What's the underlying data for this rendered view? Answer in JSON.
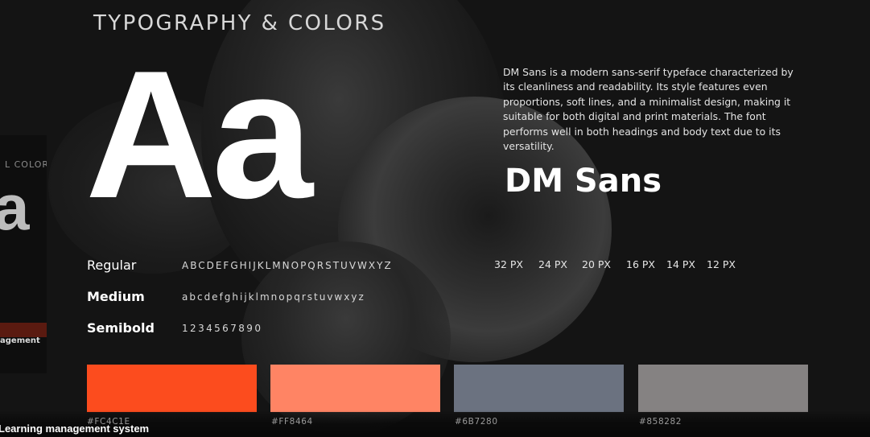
{
  "header": {
    "title": "TYPOGRAPHY & COLORS"
  },
  "specimen": {
    "big_glyphs": "Aa",
    "font_name": "DM Sans",
    "description": "DM Sans is a modern sans-serif typeface characterized by its cleanliness and readability. Its style features even proportions, soft lines, and a minimalist design, making it suitable for both digital and print materials. The font performs well in both headings and body text due to its versatility."
  },
  "weights": [
    {
      "label": "Regular"
    },
    {
      "label": "Medium"
    },
    {
      "label": "Semibold"
    }
  ],
  "glyph_rows": {
    "uppercase": "ABCDEFGHIJKLMNOPQRSTUVWXYZ",
    "lowercase": "abcdefghijklmnopqrstuvwxyz",
    "digits": "1234567890"
  },
  "sizes": [
    "32 PX",
    "24 PX",
    "20 PX",
    "16 PX",
    "14 PX",
    "12 PX"
  ],
  "palette": [
    {
      "hex": "#FC4C1E",
      "color": "#FC4C1E"
    },
    {
      "hex": "#FF8464",
      "color": "#FF8464"
    },
    {
      "hex": "#6B7280",
      "color": "#6B7280"
    },
    {
      "hex": "#858282",
      "color": "#858282"
    }
  ],
  "ghost_panel": {
    "fragment_title": "L COLOR",
    "fragment_glyph": "a",
    "fragment_label": "agement"
  },
  "footer": {
    "label": "Learning management system"
  }
}
